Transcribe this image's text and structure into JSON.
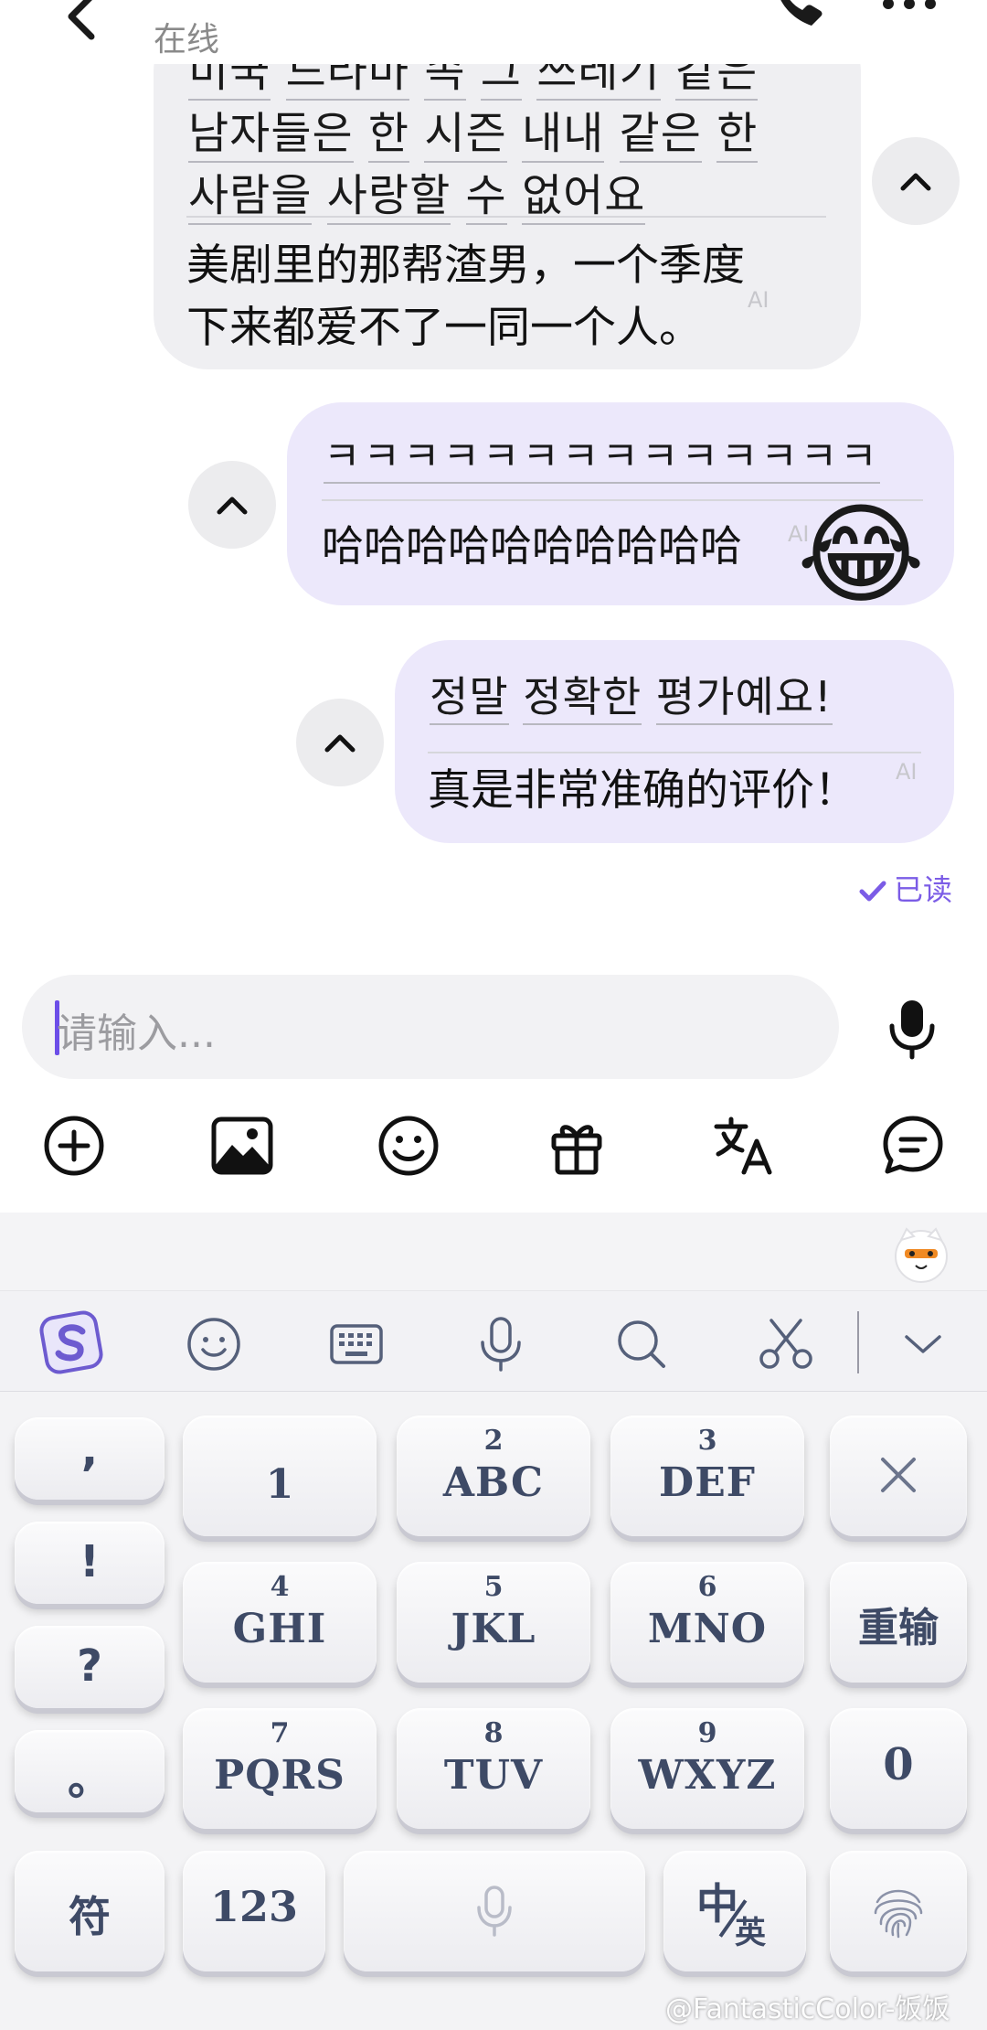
{
  "header": {
    "status": "在线",
    "back_icon": "chevron-left-icon",
    "call_icon": "phone-icon",
    "more_icon": "more-dots-icon"
  },
  "messages": [
    {
      "direction": "received",
      "original_lines": [
        [
          "미국",
          "드라마",
          "속",
          "그",
          "쓰레기",
          "같은"
        ],
        [
          "남자들은",
          "한",
          "시즌",
          "내내",
          "같은",
          "한"
        ],
        [
          "사람을",
          "사랑할",
          "수",
          "없어요"
        ]
      ],
      "translation_lines": [
        "美剧里的那帮渣男，一个季度",
        "下来都爱不了一同一个人。"
      ],
      "ai_tag": "AI"
    },
    {
      "direction": "sent",
      "original_lines": [
        [
          "ㅋㅋㅋㅋㅋㅋㅋㅋㅋㅋㅋㅋㅋㅋ"
        ]
      ],
      "translation_lines": [
        "哈哈哈哈哈哈哈哈哈哈"
      ],
      "ai_tag": "AI",
      "sticker": "😂"
    },
    {
      "direction": "sent",
      "original_lines": [
        [
          "정말",
          "정확한",
          "평가예요!"
        ]
      ],
      "translation_lines": [
        "真是非常准确的评价！"
      ],
      "ai_tag": "AI"
    }
  ],
  "read_receipt": "已读",
  "input": {
    "placeholder": "请输入..."
  },
  "toolbar": [
    "add-icon",
    "image-icon",
    "emoji-icon",
    "gift-icon",
    "translate-icon",
    "quick-reply-icon"
  ],
  "keyboard": {
    "bar_icons": [
      "sogou-logo-icon",
      "emoji-icon",
      "keyboard-icon",
      "mic-icon",
      "search-icon",
      "scissors-icon",
      "chevron-down-icon"
    ],
    "punctuation": [
      ",",
      "!",
      "?",
      "。"
    ],
    "keys": [
      {
        "num": "",
        "letters": "1"
      },
      {
        "num": "2",
        "letters": "ABC"
      },
      {
        "num": "3",
        "letters": "DEF"
      },
      {
        "num": "4",
        "letters": "GHI"
      },
      {
        "num": "5",
        "letters": "JKL"
      },
      {
        "num": "6",
        "letters": "MNO"
      },
      {
        "num": "7",
        "letters": "PQRS"
      },
      {
        "num": "8",
        "letters": "TUV"
      },
      {
        "num": "9",
        "letters": "WXYZ"
      }
    ],
    "reenter": "重输",
    "zero": "0",
    "symbols": "符",
    "numbers": "123",
    "lang_zh": "中",
    "lang_en": "英"
  },
  "watermark": "@FantasticColor-饭饭"
}
